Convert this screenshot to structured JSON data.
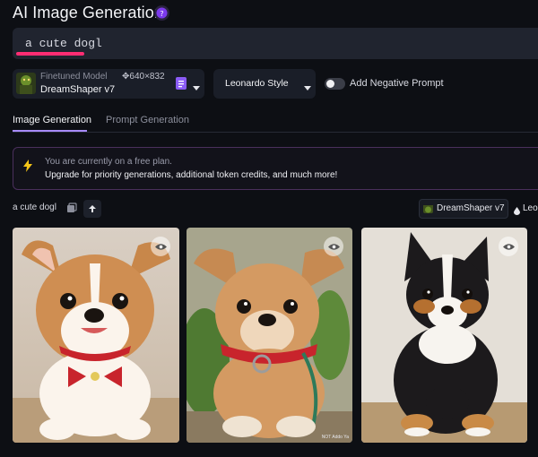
{
  "header": {
    "title": "AI Image Generation"
  },
  "prompt": {
    "text": "a cute dogl"
  },
  "model": {
    "subtitle": "Finetuned Model",
    "dimensions": "✥640×832",
    "name": "DreamShaper v7"
  },
  "style": {
    "label": "Leonardo Style"
  },
  "negative_prompt": {
    "label": "Add Negative Prompt",
    "enabled": false
  },
  "tabs": [
    {
      "label": "Image Generation",
      "active": true
    },
    {
      "label": "Prompt Generation",
      "active": false
    }
  ],
  "plan_banner": {
    "line1": "You are currently on a free plan.",
    "line2": "Upgrade for priority generations, additional token credits, and much more!"
  },
  "generation": {
    "prompt": "a cute dogl",
    "model_chip": "DreamShaper v7",
    "style_chip": "Leo"
  },
  "cards": [
    {
      "icon": "eye-icon"
    },
    {
      "icon": "eye-icon",
      "watermark": "NOT Addo Ya"
    },
    {
      "icon": "eye-icon"
    }
  ],
  "colors": {
    "accent": "#a78bfa",
    "underline": "#ff2d73",
    "tag": "#8b5cf6"
  }
}
